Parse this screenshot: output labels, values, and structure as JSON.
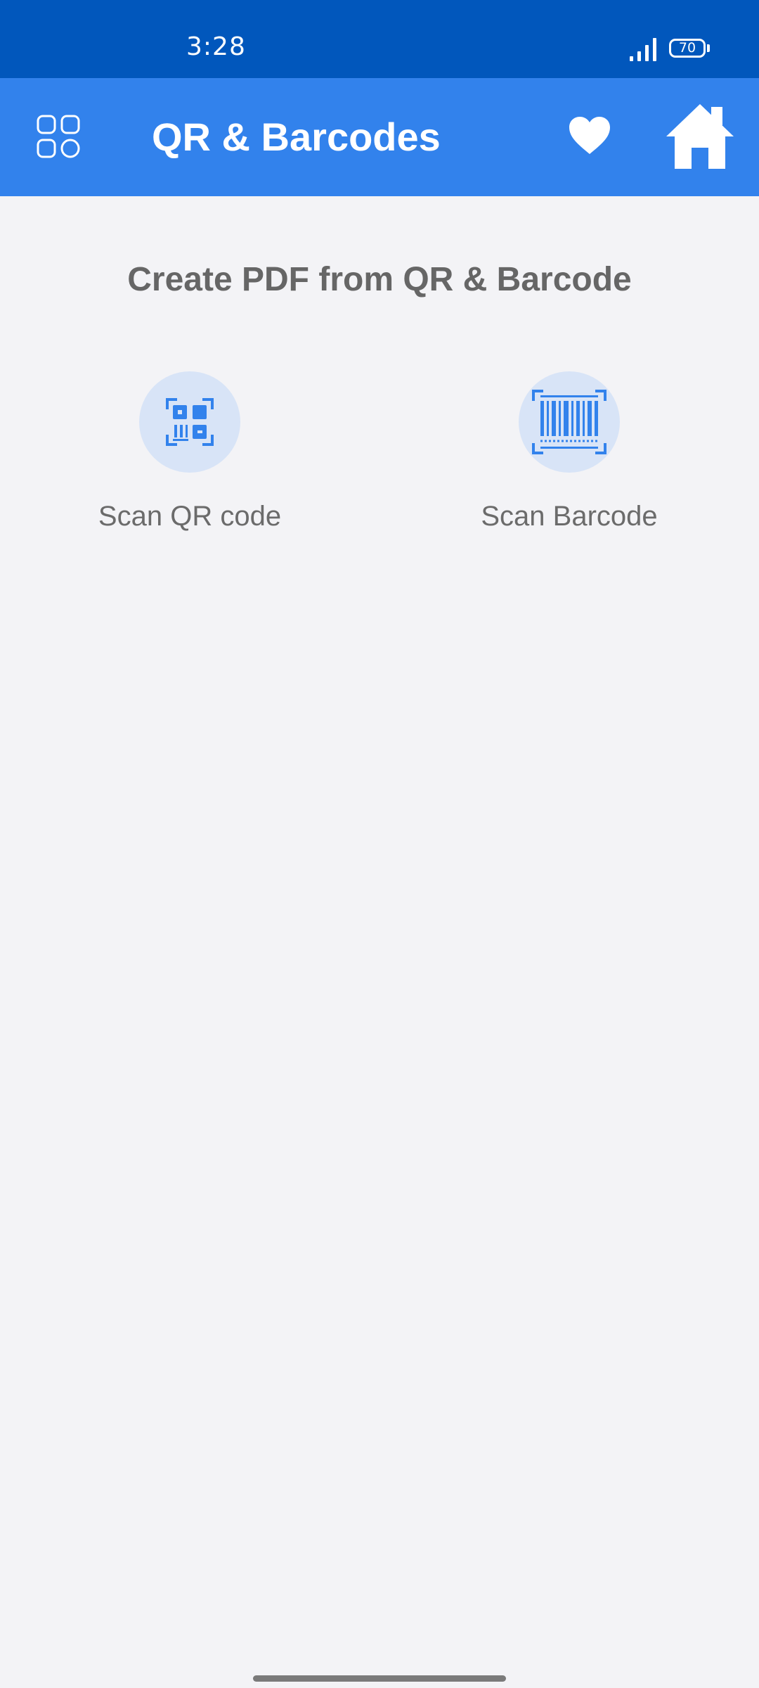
{
  "status_bar": {
    "time": "3:28",
    "battery": "70"
  },
  "app_bar": {
    "title": "QR & Barcodes",
    "icons": {
      "menu": "grid-menu-icon",
      "favorite": "heart-icon",
      "home": "home-icon"
    }
  },
  "main": {
    "section_title": "Create PDF from QR & Barcode",
    "actions": [
      {
        "label": "Scan QR code",
        "icon": "qr-code-icon"
      },
      {
        "label": "Scan Barcode",
        "icon": "barcode-icon"
      }
    ]
  },
  "colors": {
    "status_bar": "#0157BC",
    "app_bar": "#3282EC",
    "background": "#F3F3F6",
    "icon_circle": "#D8E4F7",
    "icon_accent": "#3282EC",
    "text_gray": "#666666"
  }
}
